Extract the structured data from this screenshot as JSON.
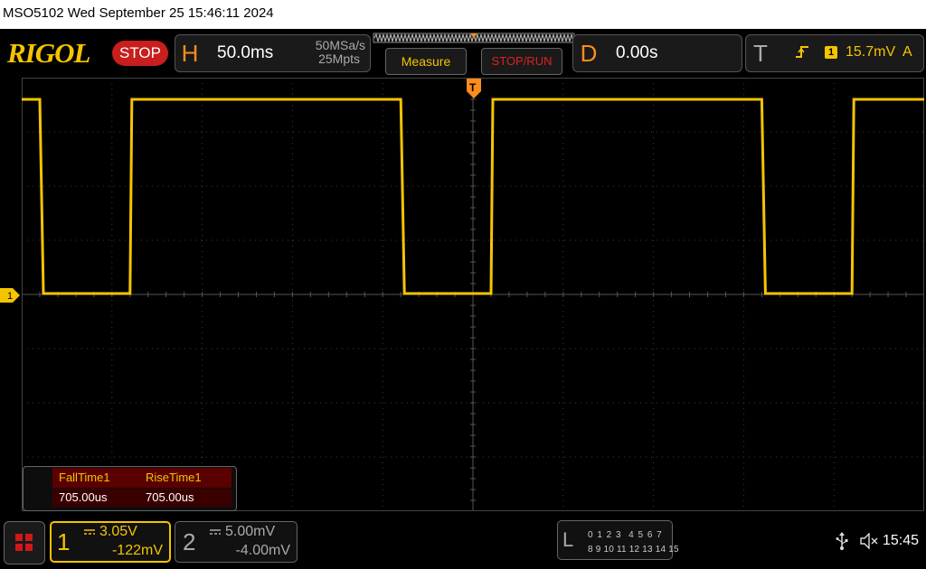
{
  "title": "MSO5102  Wed September 25 15:46:11 2024",
  "logo": "RIGOL",
  "run_state": "STOP",
  "horizontal": {
    "letter": "H",
    "timebase": "50.0ms",
    "sample_rate": "50MSa/s",
    "memory_depth": "25Mpts"
  },
  "buttons": {
    "measure": "Measure",
    "stop_run": "STOP/RUN"
  },
  "delay": {
    "letter": "D",
    "value": "0.00s"
  },
  "trigger": {
    "letter": "T",
    "channel": "1",
    "level": "15.7mV",
    "source": "A",
    "marker": "T"
  },
  "ch1_marker": "1",
  "measurements": {
    "fall_label": "FallTime1",
    "fall_value": "705.00us",
    "rise_label": "RiseTime1",
    "rise_value": "705.00us"
  },
  "channel1": {
    "number": "1",
    "coupling": "DC",
    "scale": "3.05V",
    "offset": "-122mV"
  },
  "channel2": {
    "number": "2",
    "coupling": "DC",
    "scale": "5.00mV",
    "offset": "-4.00mV"
  },
  "logic_analyzer": {
    "letter": "L",
    "row1": "0 1 2 3  4 5 6 7",
    "row2": "8 9 10 11 12 13 14 15"
  },
  "clock": "15:45",
  "colors": {
    "ch1": "#f5c400",
    "accent": "#ff8c1a",
    "stop": "#c81e1e",
    "grid": "#3c3c3c"
  },
  "waveform": {
    "high_level_div": 3.5,
    "low_level_div": 0,
    "edges_time_ms": [
      -240,
      -190,
      -40,
      10,
      160,
      210
    ],
    "edges_type": [
      "fall",
      "rise",
      "fall",
      "rise",
      "fall",
      "rise"
    ],
    "start_level": "high"
  }
}
